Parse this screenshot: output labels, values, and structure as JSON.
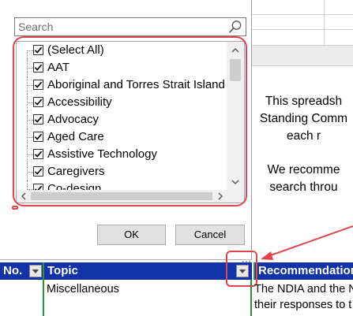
{
  "filter_panel": {
    "search_placeholder": "Search",
    "items": [
      {
        "label": "(Select All)",
        "checked": true
      },
      {
        "label": "AAT",
        "checked": true
      },
      {
        "label": "Aboriginal and Torres Strait Island",
        "checked": true
      },
      {
        "label": "Accessibility",
        "checked": true
      },
      {
        "label": "Advocacy",
        "checked": true
      },
      {
        "label": "Aged Care",
        "checked": true
      },
      {
        "label": "Assistive Technology",
        "checked": true
      },
      {
        "label": "Caregivers",
        "checked": true
      },
      {
        "label": "Co-design",
        "checked": true
      }
    ],
    "ok_label": "OK",
    "cancel_label": "Cancel"
  },
  "sheet": {
    "intro_lines_1": [
      "This spreadsh",
      "Standing Comm",
      "each r"
    ],
    "intro_lines_2": [
      "We recomme",
      "search throu"
    ],
    "headers": {
      "no": "No.",
      "topic": "Topic",
      "recommendation": "Recommendation"
    },
    "row1": {
      "no": "",
      "topic": "Miscellaneous",
      "rec_lines": [
        "The NDIA and the N",
        "their responses to t"
      ]
    }
  },
  "colors": {
    "header_bg": "#1232a8",
    "header_text": "#ffffff",
    "callout_red": "#e0454f",
    "grid_green": "#2f8f3a"
  }
}
